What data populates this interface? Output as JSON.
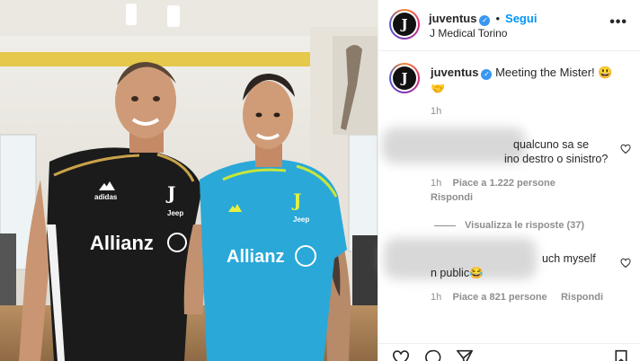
{
  "post": {
    "account": "juventus",
    "avatar_glyph": "J",
    "follow_label": "Segui",
    "separator": "•",
    "location": "J Medical Torino",
    "caption_text": "Meeting the Mister! 😃",
    "caption_emoji_2": "🤝",
    "caption_time": "1h",
    "more_icon": "more-options-icon"
  },
  "comments": [
    {
      "text_visible": "qualcuno sa se",
      "text_visible_2": "ino destro o sinistro?",
      "time": "1h",
      "likes": "Piace a 1.222 persone",
      "reply": "Rispondi",
      "view_replies": "Visualizza le risposte (37)"
    },
    {
      "text_visible": "uch myself",
      "text_visible_2": "n public😂",
      "time": "1h",
      "likes": "Piace a 821 persone",
      "reply": "Rispondi"
    }
  ],
  "photo": {
    "shirt_left_sponsor": "Allianz",
    "shirt_left_sub": "Jeep",
    "shirt_right_sponsor": "Allianz",
    "shirt_right_sub": "Jeep"
  },
  "colors": {
    "link_blue": "#0095f6",
    "verified_blue": "#3897f0",
    "kit_blue": "#2aa8d8",
    "kit_black": "#1b1b1b"
  },
  "icons": [
    "heart-icon",
    "comment-icon",
    "share-icon",
    "bookmark-icon",
    "verified-badge-icon"
  ]
}
